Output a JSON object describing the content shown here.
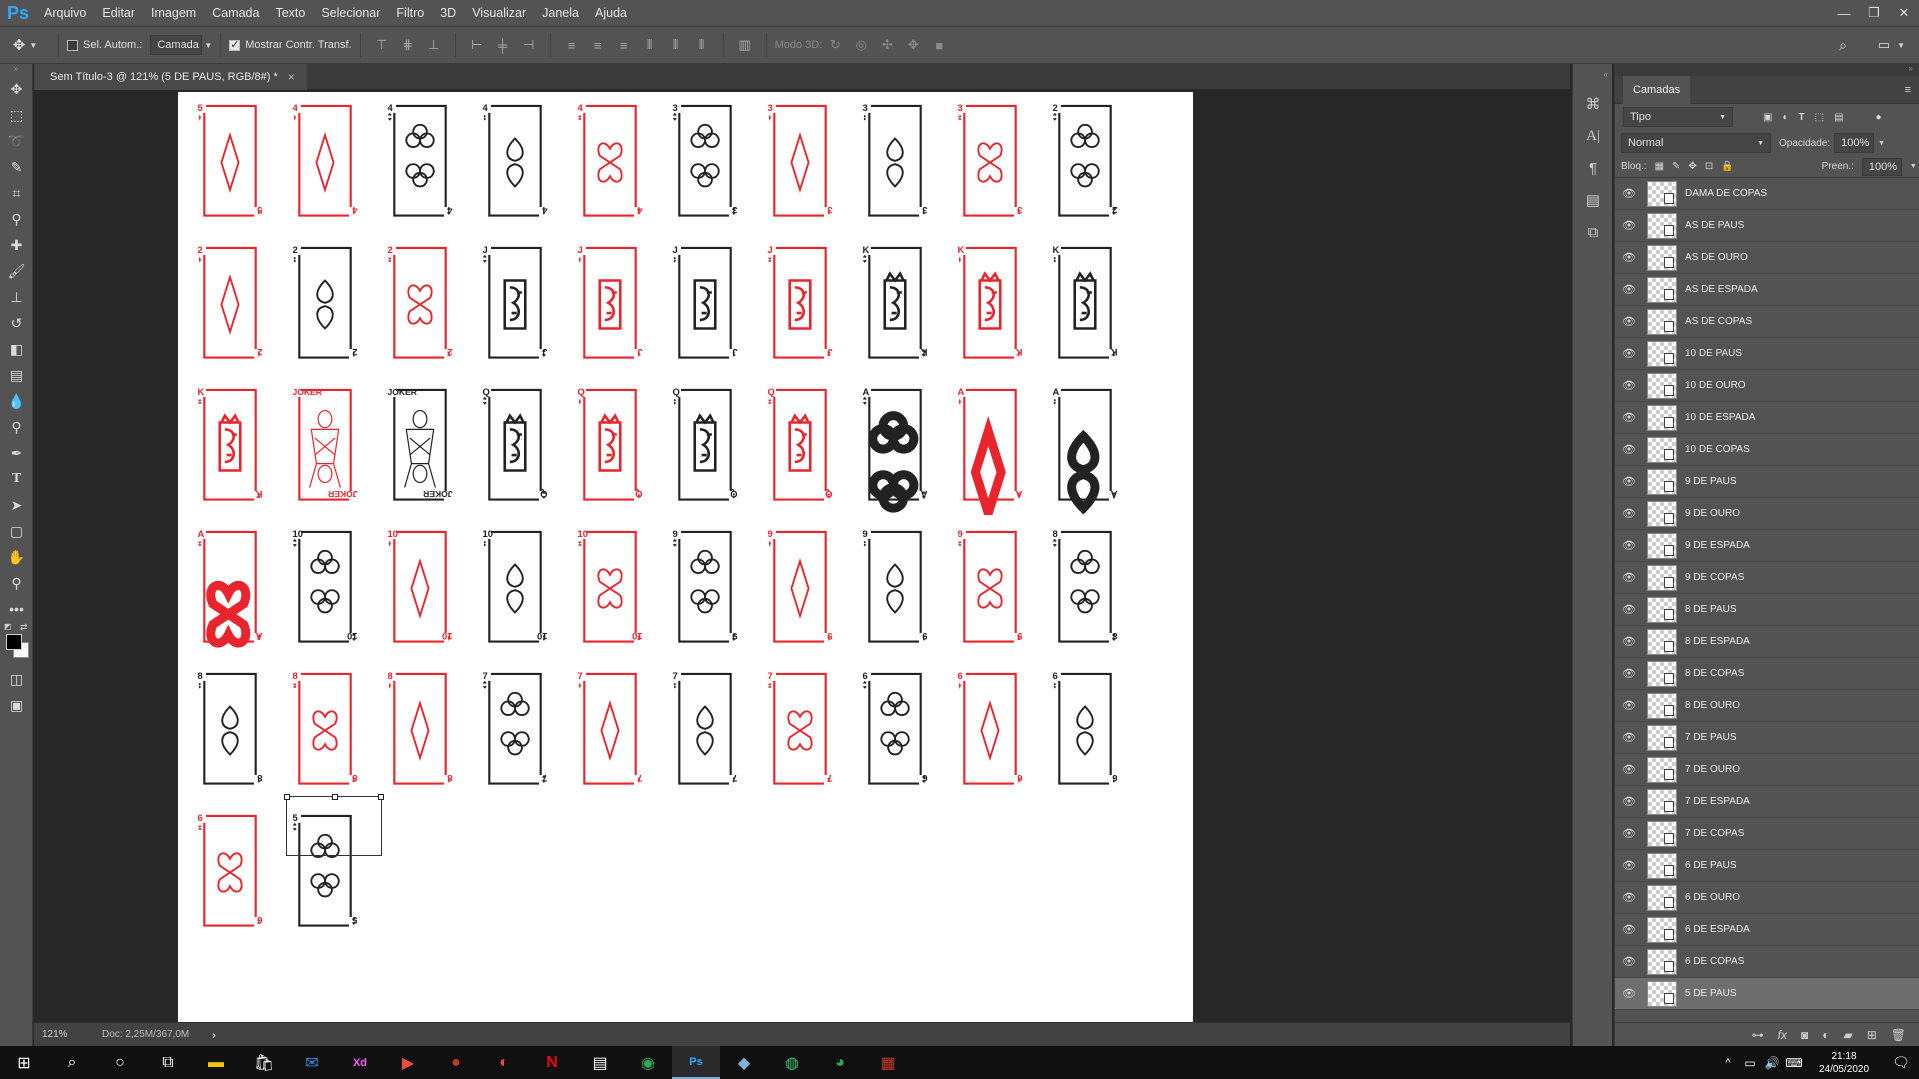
{
  "app": {
    "logo": "Ps"
  },
  "menu": [
    "Arquivo",
    "Editar",
    "Imagem",
    "Camada",
    "Texto",
    "Selecionar",
    "Filtro",
    "3D",
    "Visualizar",
    "Janela",
    "Ajuda"
  ],
  "options": {
    "auto_select_label": "Sel. Autom.:",
    "auto_select_target": "Camada",
    "show_transform_label": "Mostrar Contr. Transf.",
    "mode3d_label": "Modo 3D:"
  },
  "document": {
    "tab_title": "Sem Título-3 @ 121% (5 DE PAUS, RGB/8#) *",
    "close": "×"
  },
  "status": {
    "zoom": "121%",
    "doc_size": "Doc: 2,25M/367,0M",
    "arrow": "›"
  },
  "colors": {
    "red": "#e8242d",
    "black": "#222222",
    "panel": "#535353",
    "accent": "#31a8ff"
  },
  "cards": [
    [
      "5",
      "D"
    ],
    [
      "4",
      "D"
    ],
    [
      "4",
      "C"
    ],
    [
      "4",
      "S"
    ],
    [
      "4",
      "H"
    ],
    [
      "3",
      "C"
    ],
    [
      "3",
      "D"
    ],
    [
      "3",
      "S"
    ],
    [
      "3",
      "H"
    ],
    [
      "2",
      "C"
    ],
    [
      "2",
      "D"
    ],
    [
      "2",
      "S"
    ],
    [
      "2",
      "H"
    ],
    [
      "J",
      "C"
    ],
    [
      "J",
      "D"
    ],
    [
      "J",
      "S"
    ],
    [
      "J",
      "H"
    ],
    [
      "K",
      "C"
    ],
    [
      "K",
      "D"
    ],
    [
      "K",
      "S"
    ],
    [
      "K",
      "H"
    ],
    [
      "JOKER",
      "R"
    ],
    [
      "JOKER",
      "B"
    ],
    [
      "Q",
      "C"
    ],
    [
      "Q",
      "D"
    ],
    [
      "Q",
      "S"
    ],
    [
      "Q",
      "H"
    ],
    [
      "A",
      "C"
    ],
    [
      "A",
      "D"
    ],
    [
      "A",
      "S"
    ],
    [
      "A",
      "H"
    ],
    [
      "10",
      "C"
    ],
    [
      "10",
      "D"
    ],
    [
      "10",
      "S"
    ],
    [
      "10",
      "H"
    ],
    [
      "9",
      "C"
    ],
    [
      "9",
      "D"
    ],
    [
      "9",
      "S"
    ],
    [
      "9",
      "H"
    ],
    [
      "8",
      "C"
    ],
    [
      "8",
      "S"
    ],
    [
      "8",
      "H"
    ],
    [
      "8",
      "D"
    ],
    [
      "7",
      "C"
    ],
    [
      "7",
      "D"
    ],
    [
      "7",
      "S"
    ],
    [
      "7",
      "H"
    ],
    [
      "6",
      "C"
    ],
    [
      "6",
      "D"
    ],
    [
      "6",
      "S"
    ],
    [
      "6",
      "H"
    ],
    [
      "5",
      "C"
    ]
  ],
  "layers_panel": {
    "title": "Camadas",
    "filter_label": "Tipo",
    "blend_mode": "Normal",
    "opacity_label": "Opacidade:",
    "opacity_value": "100%",
    "lock_label": "Bloq.:",
    "fill_label": "Preen.:",
    "fill_value": "100%",
    "layers": [
      "DAMA DE COPAS",
      "AS DE PAUS",
      "AS DE OURO",
      "AS DE ESPADA",
      "AS DE COPAS",
      "10 DE PAUS",
      "10 DE OURO",
      "10 DE ESPADA",
      "10 DE COPAS",
      "9 DE PAUS",
      "9 DE OURO",
      "9 DE ESPADA",
      "9 DE COPAS",
      "8 DE PAUS",
      "8 DE ESPADA",
      "8 DE COPAS",
      "8  DE OURO",
      "7 DE PAUS",
      "7 DE OURO",
      "7 DE ESPADA",
      "7 DE COPAS",
      "6 DE PAUS",
      "6 DE OURO",
      "6 DE ESPADA",
      "6 DE COPAS",
      "5 DE PAUS"
    ],
    "selected_layer": "5 DE PAUS"
  },
  "taskbar": {
    "time": "21:18",
    "date": "24/05/2020"
  }
}
